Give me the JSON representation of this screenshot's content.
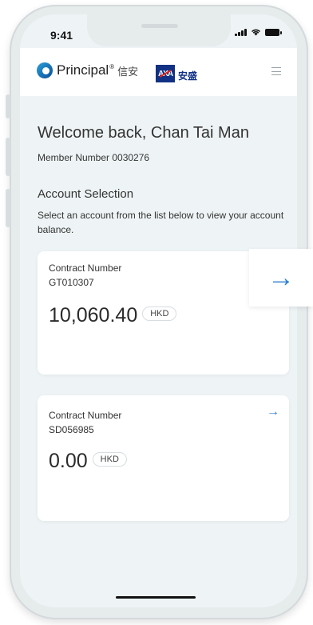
{
  "status_bar": {
    "time": "9:41"
  },
  "header": {
    "brand_name": "Principal",
    "brand_mark": "®",
    "brand_cn": "信安",
    "partner_logo_text": "AXA",
    "partner_cn": "安盛"
  },
  "welcome": {
    "greeting": "Welcome back, Chan Tai Man",
    "member_number": "Member Number 0030276"
  },
  "account_selection": {
    "title": "Account Selection",
    "description": "Select an account from the list below to view your account balance."
  },
  "accounts": [
    {
      "label": "Contract Number",
      "number": "GT010307",
      "amount": "10,060.40",
      "currency": "HKD"
    },
    {
      "label": "Contract Number",
      "number": "SD056985",
      "amount": "0.00",
      "currency": "HKD"
    }
  ],
  "icons": {
    "arrow": "→",
    "accent_color": "#2a7fd0"
  }
}
